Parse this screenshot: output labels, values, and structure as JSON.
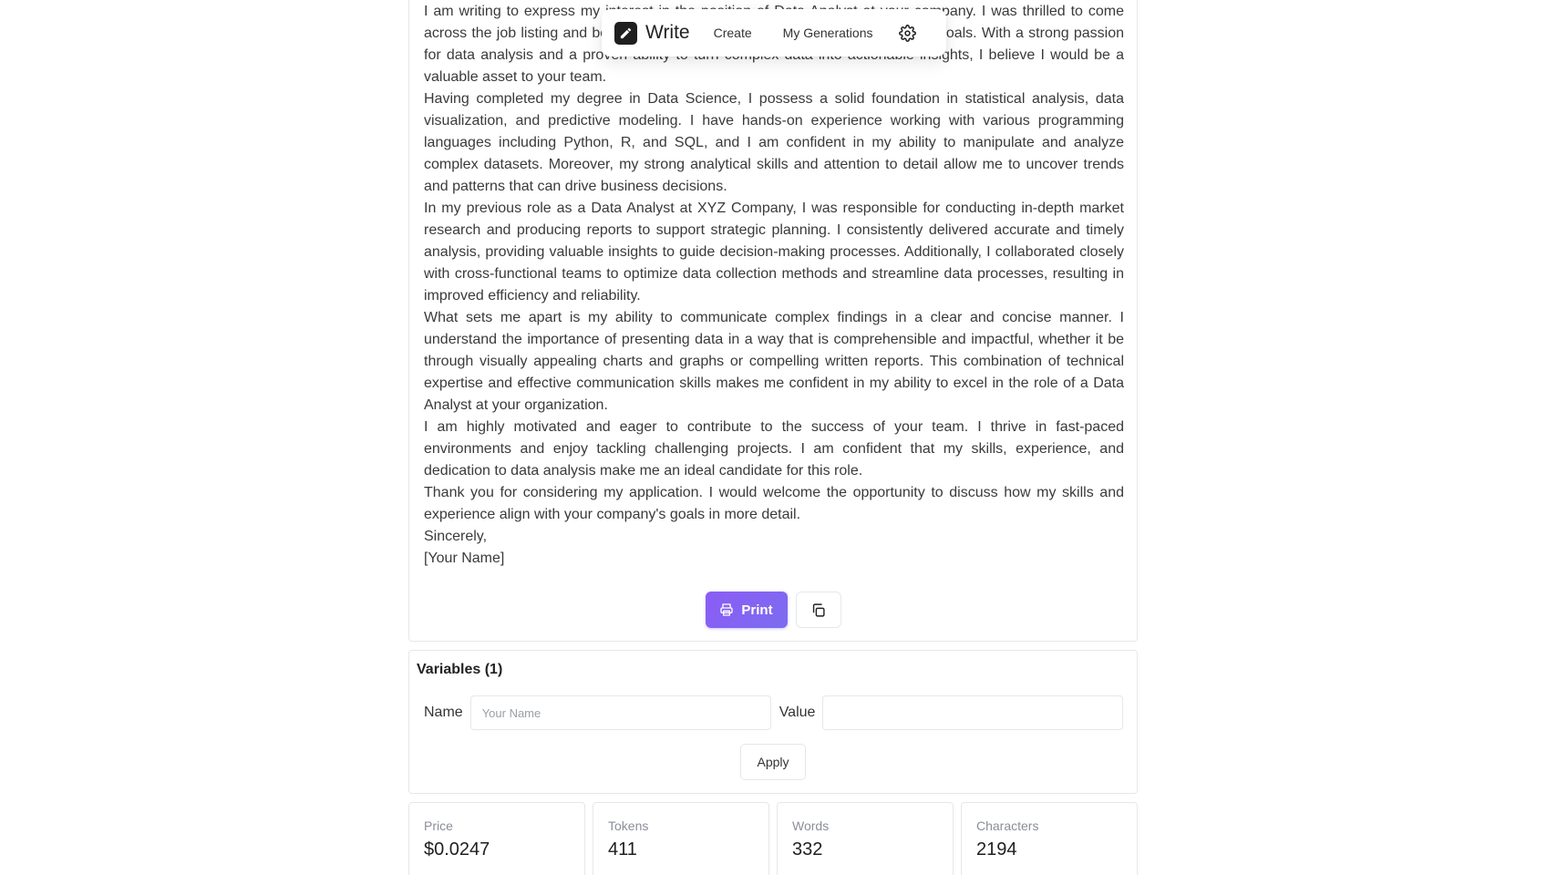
{
  "nav": {
    "brand": "Write",
    "links": [
      "Create",
      "My Generations"
    ],
    "settings_icon": "gear-icon"
  },
  "letter": {
    "paragraphs": [
      "I am writing to express my interest in the position of Data Analyst at your company. I was thrilled to come across the job listing and believe my skills and experience align well with your goals. With a strong passion for data analysis and a proven ability to turn complex data into actionable insights, I believe I would be a valuable asset to your team.",
      "Having completed my degree in Data Science, I possess a solid foundation in statistical analysis, data visualization, and predictive modeling. I have hands-on experience working with various programming languages including Python, R, and SQL, and I am confident in my ability to manipulate and analyze complex datasets. Moreover, my strong analytical skills and attention to detail allow me to uncover trends and patterns that can drive business decisions.",
      "In my previous role as a Data Analyst at XYZ Company, I was responsible for conducting in-depth market research and producing reports to support strategic planning. I consistently delivered accurate and timely analysis, providing valuable insights to guide decision-making processes. Additionally, I collaborated closely with cross-functional teams to optimize data collection methods and streamline data processes, resulting in improved efficiency and reliability.",
      "What sets me apart is my ability to communicate complex findings in a clear and concise manner. I understand the importance of presenting data in a way that is comprehensible and impactful, whether it be through visually appealing charts and graphs or compelling written reports. This combination of technical expertise and effective communication skills makes me confident in my ability to excel in the role of a Data Analyst at your organization.",
      "I am highly motivated and eager to contribute to the success of your team. I thrive in fast-paced environments and enjoy tackling challenging projects. I am confident that my skills, experience, and dedication to data analysis make me an ideal candidate for this role.",
      "Thank you for considering my application. I would welcome the opportunity to discuss how my skills and experience align with your company's goals in more detail."
    ],
    "closing": "Sincerely,",
    "signature": "[Your Name]"
  },
  "actions": {
    "print_label": "Print",
    "print_icon": "printer-icon",
    "copy_icon": "copy-icon"
  },
  "variables": {
    "title": "Variables (1)",
    "name_label": "Name",
    "name_placeholder": "Your Name",
    "value_label": "Value",
    "value_value": "",
    "apply_label": "Apply"
  },
  "stats": [
    {
      "label": "Price",
      "value": "$0.0247"
    },
    {
      "label": "Tokens",
      "value": "411"
    },
    {
      "label": "Words",
      "value": "332"
    },
    {
      "label": "Characters",
      "value": "2194"
    }
  ],
  "colors": {
    "accent": "#8b5cf6",
    "border": "#e5e7eb",
    "muted": "#8a8f98"
  }
}
